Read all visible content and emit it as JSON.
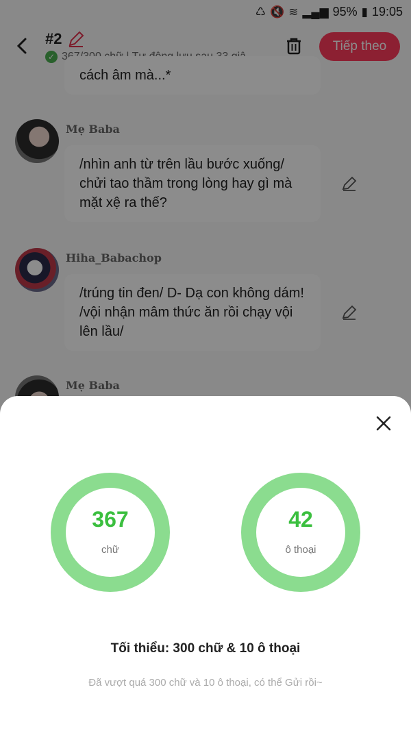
{
  "status": {
    "battery": "95%",
    "time": "19:05"
  },
  "header": {
    "title": "#2",
    "subline": "367/300 chữ | Tự động lưu sau 33 giâ",
    "next_label": "Tiếp theo"
  },
  "chat": {
    "messages": [
      {
        "text": "cách âm mà...*"
      },
      {
        "user": "Mẹ Baba",
        "text": "/nhìn anh từ trên lầu bước xuống/ chửi tao thầm trong lòng hay gì mà mặt xệ ra thế?"
      },
      {
        "user": "Hiha_Babachop",
        "text": "/trúng tin đen/ D- Dạ con không dám! /vội nhận mâm thức ăn rồi chạy vội lên lầu/"
      },
      {
        "user": "Mẹ Baba"
      }
    ]
  },
  "sheet": {
    "words_value": "367",
    "words_label": "chữ",
    "dialogs_value": "42",
    "dialogs_label": "ô thoại",
    "minimum": "Tối thiểu: 300 chữ & 10 ô thoại",
    "note": "Đã vượt quá 300 chữ và 10 ô thoại, có thể Gửi rồi~"
  },
  "colors": {
    "accent": "#ff3b5c",
    "ring": "#8bdc8f",
    "ring_text": "#3bbf3f"
  }
}
